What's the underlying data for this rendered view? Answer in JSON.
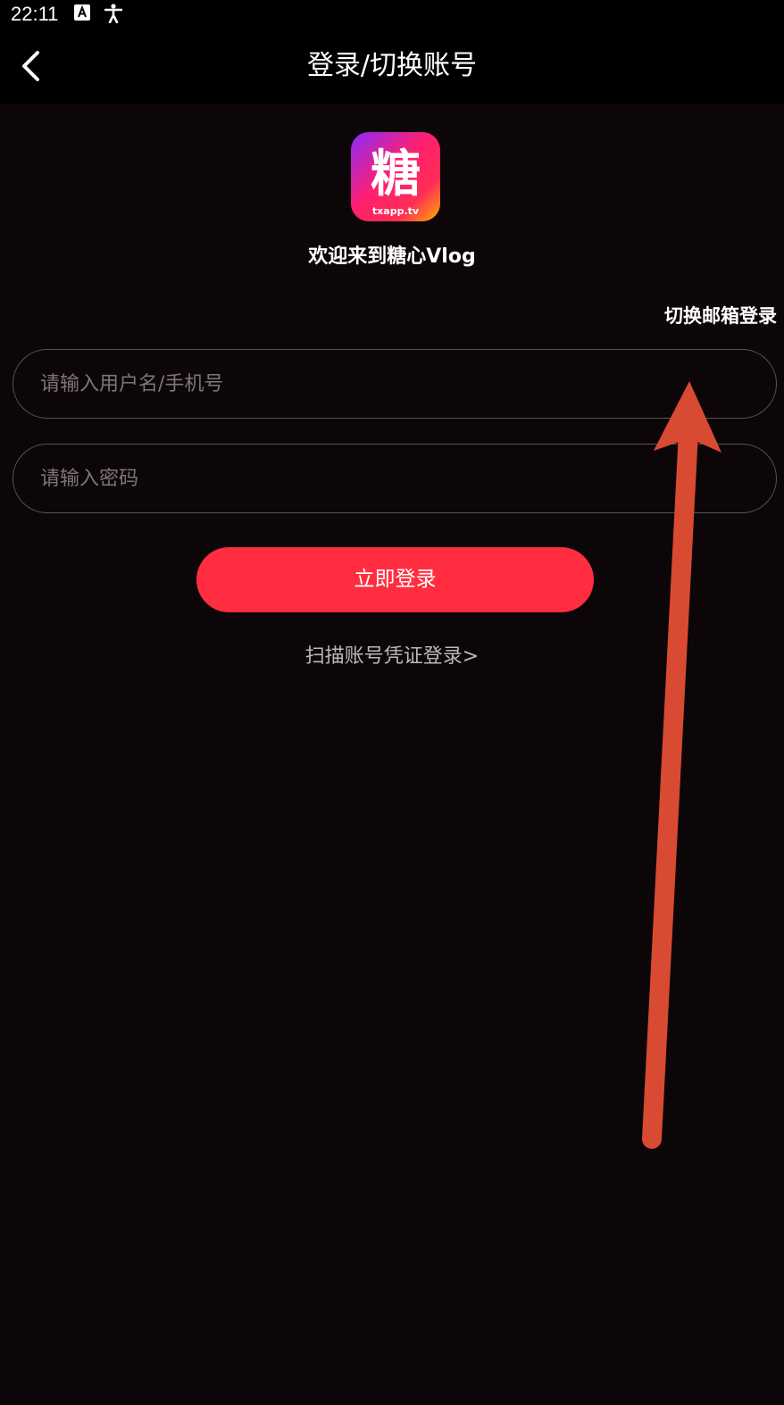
{
  "status_bar": {
    "time": "22:11",
    "icons": [
      "keyboard-a-icon",
      "accessibility-icon"
    ]
  },
  "header": {
    "back_icon": "chevron-left-icon",
    "title": "登录/切换账号"
  },
  "logo": {
    "glyph": "糖",
    "subtext": "txapp.tv"
  },
  "welcome_text": "欢迎来到糖心Vlog",
  "switch_email_login": "切换邮箱登录",
  "form": {
    "username_placeholder": "请输入用户名/手机号",
    "password_placeholder": "请输入密码",
    "login_button": "立即登录",
    "scan_link": "扫描账号凭证登录>"
  },
  "colors": {
    "background": "#0d0609",
    "bar": "#000000",
    "accent": "#ff2d3f",
    "annotation_arrow": "#d94a32"
  }
}
